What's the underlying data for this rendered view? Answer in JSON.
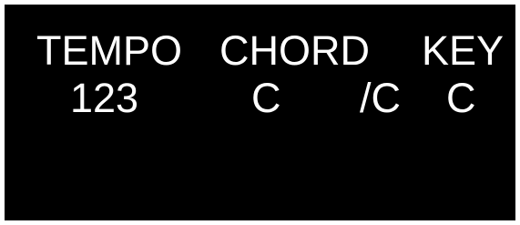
{
  "display": {
    "headers": {
      "tempo": "TEMPO",
      "chord": "CHORD",
      "key": "KEY"
    },
    "values": {
      "tempo": "123",
      "chord_root": "C",
      "chord_bass": "/C",
      "key": "C"
    },
    "colors": {
      "background": "#000000",
      "text": "#ffffff",
      "frame": "#ffffff"
    }
  }
}
